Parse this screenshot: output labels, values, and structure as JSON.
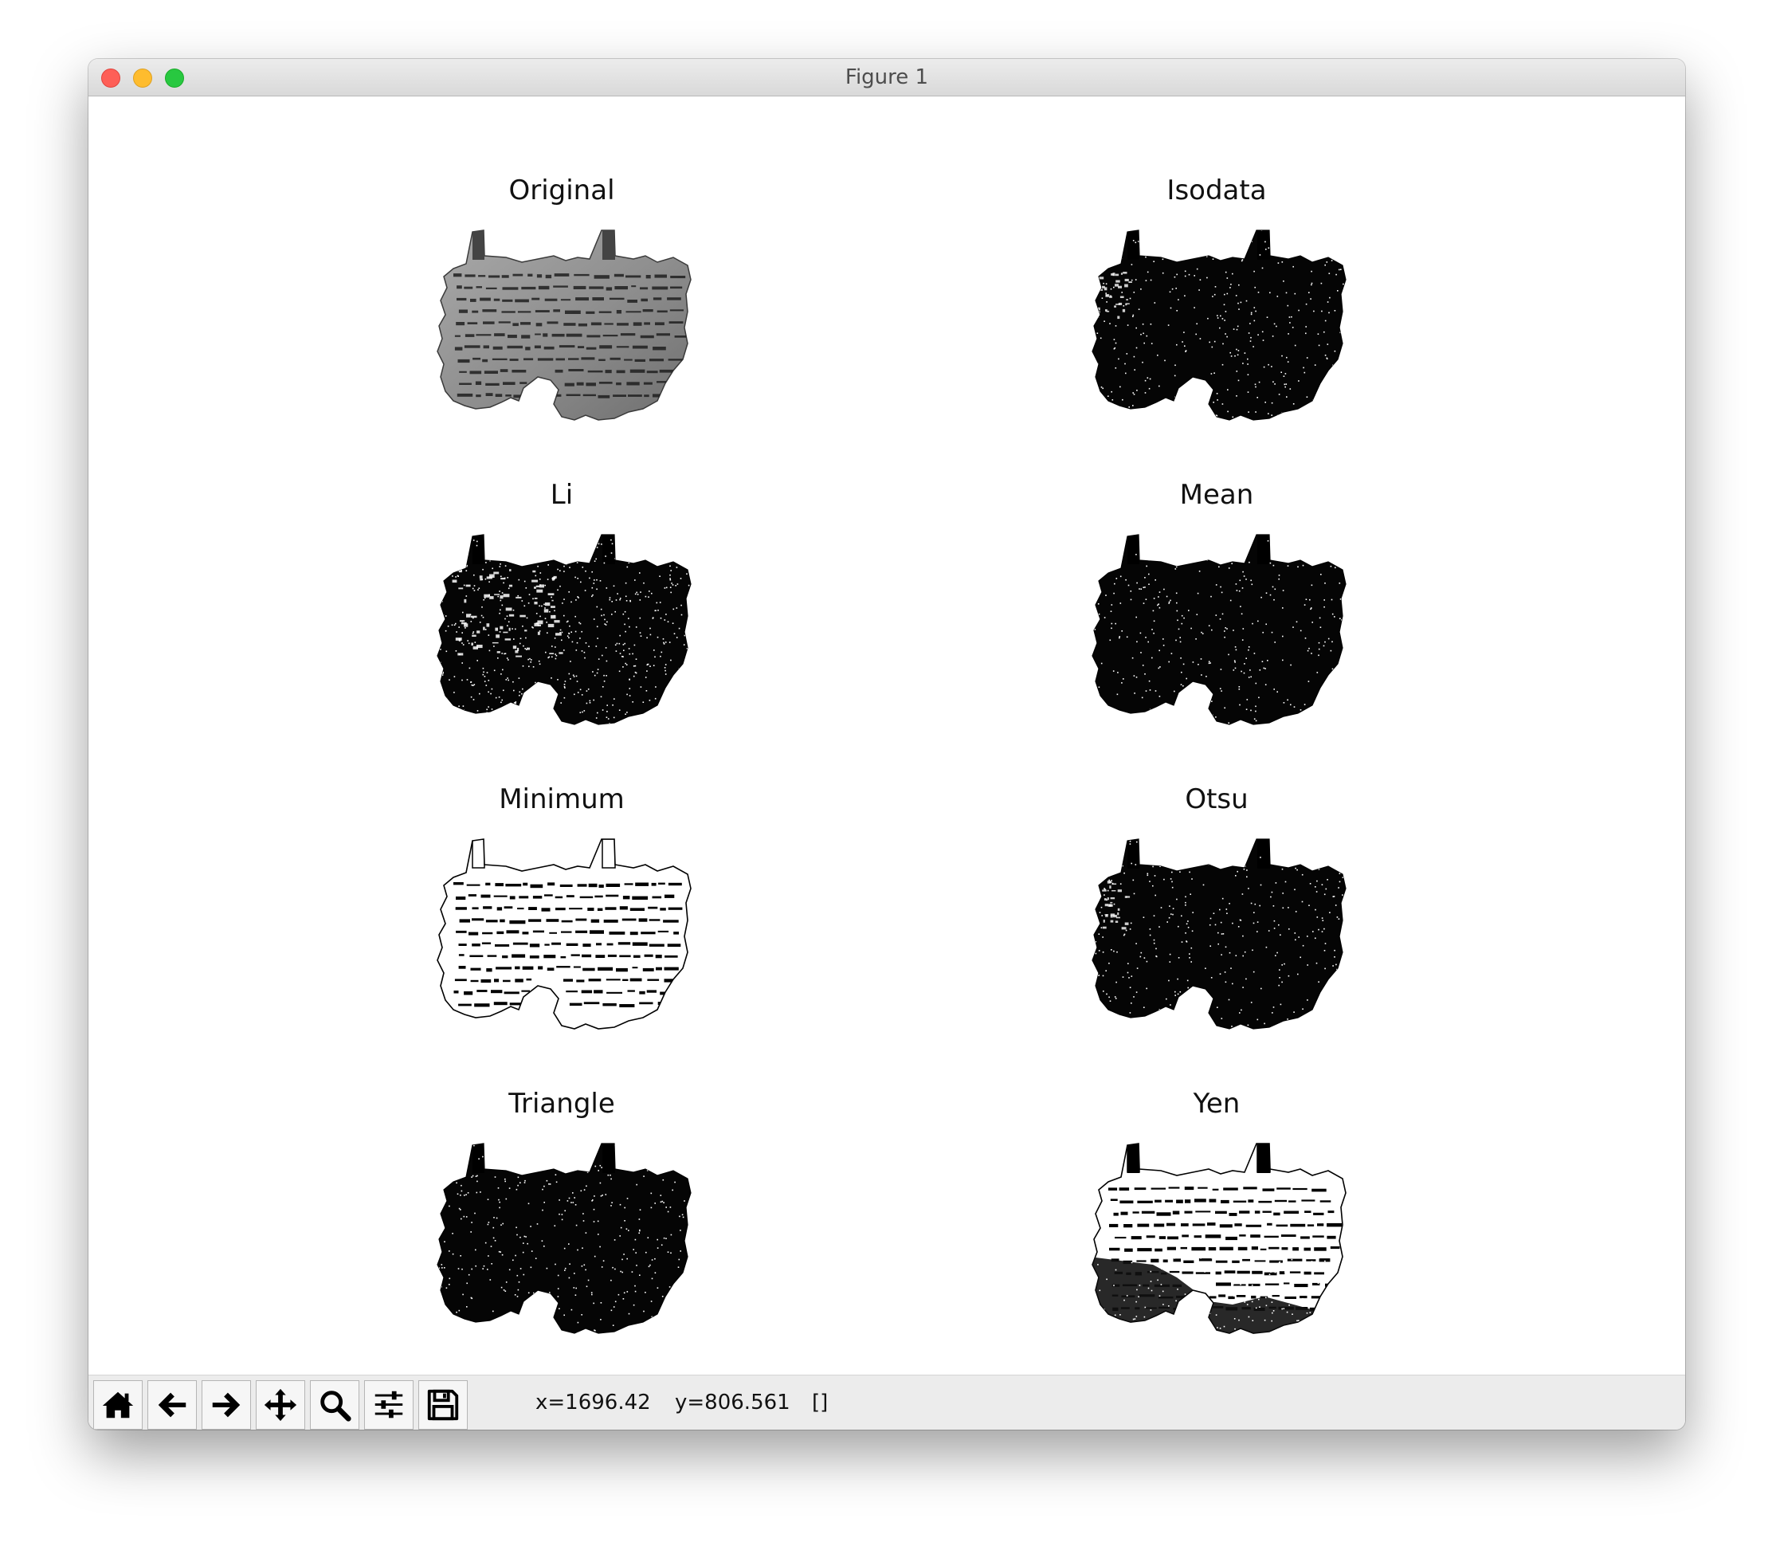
{
  "window": {
    "title": "Figure 1"
  },
  "figure": {
    "panels": [
      {
        "title": "Original",
        "style": "grayscale"
      },
      {
        "title": "Isodata",
        "style": "dark"
      },
      {
        "title": "Li",
        "style": "dark-patchy"
      },
      {
        "title": "Mean",
        "style": "dark"
      },
      {
        "title": "Minimum",
        "style": "white-text"
      },
      {
        "title": "Otsu",
        "style": "dark"
      },
      {
        "title": "Triangle",
        "style": "dark"
      },
      {
        "title": "Yen",
        "style": "white-text-dark-lower"
      }
    ]
  },
  "toolbar": {
    "buttons": [
      {
        "name": "home-icon",
        "tooltip": "Reset original view"
      },
      {
        "name": "back-arrow-icon",
        "tooltip": "Back to previous view"
      },
      {
        "name": "forward-arrow-icon",
        "tooltip": "Forward to next view"
      },
      {
        "name": "pan-icon",
        "tooltip": "Pan axes"
      },
      {
        "name": "zoom-icon",
        "tooltip": "Zoom to rectangle"
      },
      {
        "name": "subplots-icon",
        "tooltip": "Configure subplots"
      },
      {
        "name": "save-icon",
        "tooltip": "Save the figure"
      }
    ],
    "x_readout": "x=1696.42",
    "y_readout": "y=806.561",
    "value_readout": "[]"
  },
  "colors": {
    "close": "#fe5f57",
    "minimize": "#febc2e",
    "maximize": "#28c840",
    "toolbar_bg": "#ececec"
  }
}
